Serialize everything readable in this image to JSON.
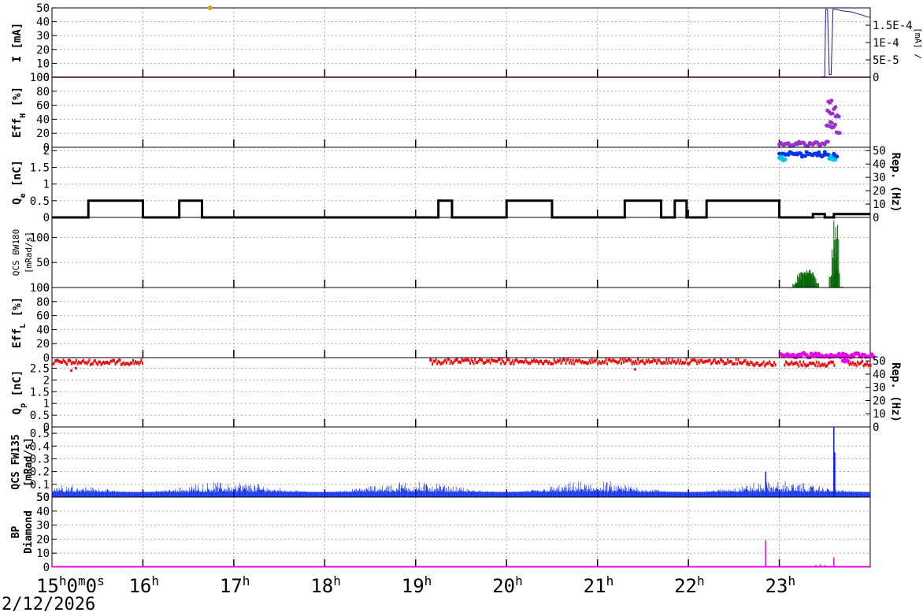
{
  "date": "2/12/2026",
  "time_axis": {
    "start_hour": 15,
    "end_hour": 24,
    "first_label": {
      "main": "15",
      "sup_h": "h",
      "mid": "0",
      "sup_m": "m",
      "end": "0",
      "sup_s": "s"
    },
    "hour_labels": [
      "16",
      "17",
      "18",
      "19",
      "20",
      "21",
      "22",
      "23"
    ],
    "hour_sup": "h"
  },
  "chart_data": [
    {
      "type": "line",
      "ylabel": "I [mA]",
      "ylim": [
        0,
        50
      ],
      "yticks": [
        "0",
        "10",
        "20",
        "30",
        "40",
        "50"
      ],
      "right_axis": {
        "ylim": [
          0,
          0.0002
        ],
        "ticks": [
          "0",
          "5E-5",
          "1E-4",
          "1.5E-4"
        ],
        "label_fragment": "[mA] /"
      },
      "series": [
        {
          "color": "#1a1aa0",
          "points": [
            [
              15.0,
              0
            ],
            [
              23.45,
              0
            ],
            [
              23.5,
              0.5
            ],
            [
              23.51,
              49
            ],
            [
              23.53,
              49
            ],
            [
              23.55,
              2
            ],
            [
              23.57,
              2
            ],
            [
              23.59,
              49
            ],
            [
              23.62,
              49
            ],
            [
              23.68,
              48
            ],
            [
              23.8,
              47
            ],
            [
              23.9,
              45
            ],
            [
              24.0,
              43
            ]
          ]
        },
        {
          "color": "#d4a017",
          "points": [
            [
              16.74,
              50
            ]
          ]
        },
        {
          "color": "#cc0000",
          "points": [
            [
              15.0,
              0
            ],
            [
              24.0,
              0
            ]
          ]
        }
      ]
    },
    {
      "type": "scatter",
      "ylabel": "Eff",
      "ylabel_sub": "H",
      "ylabel_suffix": " [%]",
      "ylim": [
        0,
        100
      ],
      "yticks": [
        "0",
        "20",
        "40",
        "60",
        "80",
        "100"
      ],
      "series": [
        {
          "color": "#9932cc",
          "points": [
            [
              23.0,
              5
            ],
            [
              23.05,
              6
            ],
            [
              23.1,
              4
            ],
            [
              23.15,
              5
            ],
            [
              23.2,
              6
            ],
            [
              23.25,
              5
            ],
            [
              23.3,
              4
            ],
            [
              23.35,
              5
            ],
            [
              23.4,
              6
            ],
            [
              23.45,
              5
            ],
            [
              23.5,
              6
            ],
            [
              23.52,
              30
            ],
            [
              23.53,
              55
            ],
            [
              23.54,
              65
            ],
            [
              23.55,
              50
            ],
            [
              23.56,
              35
            ],
            [
              23.58,
              30
            ],
            [
              23.6,
              55
            ],
            [
              23.62,
              45
            ],
            [
              23.63,
              20
            ]
          ]
        }
      ]
    },
    {
      "type": "scatter",
      "ylabel": "Q",
      "ylabel_sub": "e",
      "ylabel_suffix": " [nC]",
      "ylim": [
        0,
        2.1
      ],
      "yticks": [
        "0",
        "0.5",
        "1",
        "1.5",
        "2"
      ],
      "right_axis": {
        "ylim": [
          0,
          52.5
        ],
        "ticks": [
          "0",
          "10",
          "20",
          "30",
          "40",
          "50"
        ],
        "label": "Rep. (Hz)"
      },
      "series": [
        {
          "name": "Q",
          "color": "#0033ee",
          "points": [
            [
              23.0,
              1.9
            ],
            [
              23.05,
              1.85
            ],
            [
              23.1,
              1.9
            ],
            [
              23.15,
              1.88
            ],
            [
              23.2,
              1.92
            ],
            [
              23.25,
              1.86
            ],
            [
              23.3,
              1.9
            ],
            [
              23.35,
              1.88
            ],
            [
              23.4,
              1.91
            ],
            [
              23.45,
              1.87
            ],
            [
              23.5,
              1.9
            ],
            [
              23.55,
              1.85
            ],
            [
              23.6,
              1.88
            ]
          ]
        },
        {
          "name": "Q2",
          "color": "#00c8e0",
          "points": [
            [
              23.0,
              1.78
            ],
            [
              23.03,
              1.75
            ],
            [
              23.55,
              1.78
            ],
            [
              23.58,
              1.72
            ]
          ]
        },
        {
          "name": "Rep",
          "color": "#000000",
          "step": [
            [
              15.0,
              0
            ],
            [
              15.4,
              0
            ],
            [
              15.4,
              12.5
            ],
            [
              16.0,
              12.5
            ],
            [
              16.0,
              0
            ],
            [
              16.4,
              0
            ],
            [
              16.4,
              12.5
            ],
            [
              16.65,
              12.5
            ],
            [
              16.65,
              0
            ],
            [
              19.25,
              0
            ],
            [
              19.25,
              12.5
            ],
            [
              19.4,
              12.5
            ],
            [
              19.4,
              0
            ],
            [
              20.0,
              0
            ],
            [
              20.0,
              12.5
            ],
            [
              20.5,
              12.5
            ],
            [
              20.5,
              0
            ],
            [
              21.3,
              0
            ],
            [
              21.3,
              12.5
            ],
            [
              21.7,
              12.5
            ],
            [
              21.7,
              0
            ],
            [
              21.85,
              0
            ],
            [
              21.85,
              12.5
            ],
            [
              21.98,
              12.5
            ],
            [
              21.98,
              0
            ],
            [
              22.2,
              0
            ],
            [
              22.2,
              12.5
            ],
            [
              23.0,
              12.5
            ],
            [
              23.0,
              0
            ],
            [
              23.37,
              0
            ],
            [
              23.37,
              2.5
            ],
            [
              23.5,
              2.5
            ],
            [
              23.5,
              0
            ],
            [
              23.6,
              0
            ],
            [
              23.6,
              2.5
            ],
            [
              24.0,
              2.5
            ]
          ]
        }
      ]
    },
    {
      "type": "bar",
      "ylabel": "QCS BW180",
      "ylabel2": "[mRad/s]",
      "ylim": [
        0,
        140
      ],
      "yticks": [
        "0",
        "50",
        "100"
      ],
      "series": [
        {
          "color": "#006400",
          "points": [
            [
              23.15,
              8
            ],
            [
              23.18,
              15
            ],
            [
              23.2,
              25
            ],
            [
              23.22,
              35
            ],
            [
              23.25,
              30
            ],
            [
              23.28,
              40
            ],
            [
              23.3,
              32
            ],
            [
              23.33,
              38
            ],
            [
              23.35,
              28
            ],
            [
              23.38,
              10
            ],
            [
              23.55,
              30
            ],
            [
              23.58,
              80
            ],
            [
              23.6,
              135
            ],
            [
              23.61,
              40
            ],
            [
              23.65,
              2
            ]
          ]
        }
      ]
    },
    {
      "type": "scatter",
      "ylabel": "Eff",
      "ylabel_sub": "L",
      "ylabel_suffix": " [%]",
      "ylim": [
        0,
        100
      ],
      "yticks": [
        "0",
        "20",
        "40",
        "60",
        "80",
        "100"
      ],
      "series": [
        {
          "color": "#ee00ee",
          "points": [
            [
              23.02,
              4
            ],
            [
              23.1,
              3
            ],
            [
              23.2,
              4
            ],
            [
              23.3,
              3
            ],
            [
              23.4,
              4
            ],
            [
              23.5,
              3
            ],
            [
              23.7,
              3
            ],
            [
              23.8,
              4
            ],
            [
              23.9,
              3
            ],
            [
              24.0,
              3
            ]
          ]
        }
      ]
    },
    {
      "type": "scatter",
      "ylabel": "Q",
      "ylabel_sub": "p",
      "ylabel_suffix": " [nC]",
      "ylim": [
        0,
        2.95
      ],
      "yticks": [
        "0",
        "0.5",
        "1",
        "1.5",
        "2",
        "2.5"
      ],
      "right_axis": {
        "ylim": [
          0,
          52.5
        ],
        "ticks": [
          "0",
          "10",
          "20",
          "30",
          "40",
          "50"
        ],
        "label": "Rep. (Hz)"
      },
      "series": [
        {
          "color": "#ee1111",
          "segments": [
            [
              15.0,
              16.0,
              2.75
            ],
            [
              19.15,
              22.65,
              2.78
            ],
            [
              22.65,
              22.95,
              2.7
            ],
            [
              23.05,
              23.6,
              2.68
            ],
            [
              23.75,
              24.0,
              2.7
            ]
          ],
          "outliers": [
            [
              15.2,
              2.4
            ],
            [
              15.25,
              2.5
            ],
            [
              21.4,
              2.45
            ]
          ]
        },
        {
          "color": "#ee00ee",
          "points": [
            [
              23.7,
              2.85
            ],
            [
              23.72,
              2.85
            ]
          ]
        }
      ]
    },
    {
      "type": "bar",
      "ylabel": "QCS FW135",
      "ylabel2": "[mRad/s]",
      "ylim": [
        0,
        0.55
      ],
      "yticks": [
        "0.1",
        "0.2",
        "0.3",
        "0.4",
        "0.5"
      ],
      "bottom_tick": "50",
      "series": [
        {
          "color": "#0022ee",
          "noise": {
            "x_start": 15.0,
            "x_end": 24.0,
            "base": 0.04,
            "amplitude": 0.1
          },
          "spikes": [
            [
              22.85,
              0.2
            ],
            [
              23.6,
              0.55
            ],
            [
              23.61,
              0.35
            ]
          ]
        }
      ]
    },
    {
      "type": "bar",
      "ylabel": "BP",
      "ylabel2": "Diamond",
      "ylim": [
        0,
        50
      ],
      "yticks": [
        "0",
        "10",
        "20",
        "30",
        "40",
        "50"
      ],
      "series": [
        {
          "color": "#ee00ee",
          "baseline": 0.3,
          "spikes": [
            [
              22.85,
              19
            ],
            [
              23.4,
              1.5
            ],
            [
              23.45,
              2
            ],
            [
              23.5,
              1.5
            ],
            [
              23.6,
              7
            ]
          ]
        }
      ]
    }
  ]
}
